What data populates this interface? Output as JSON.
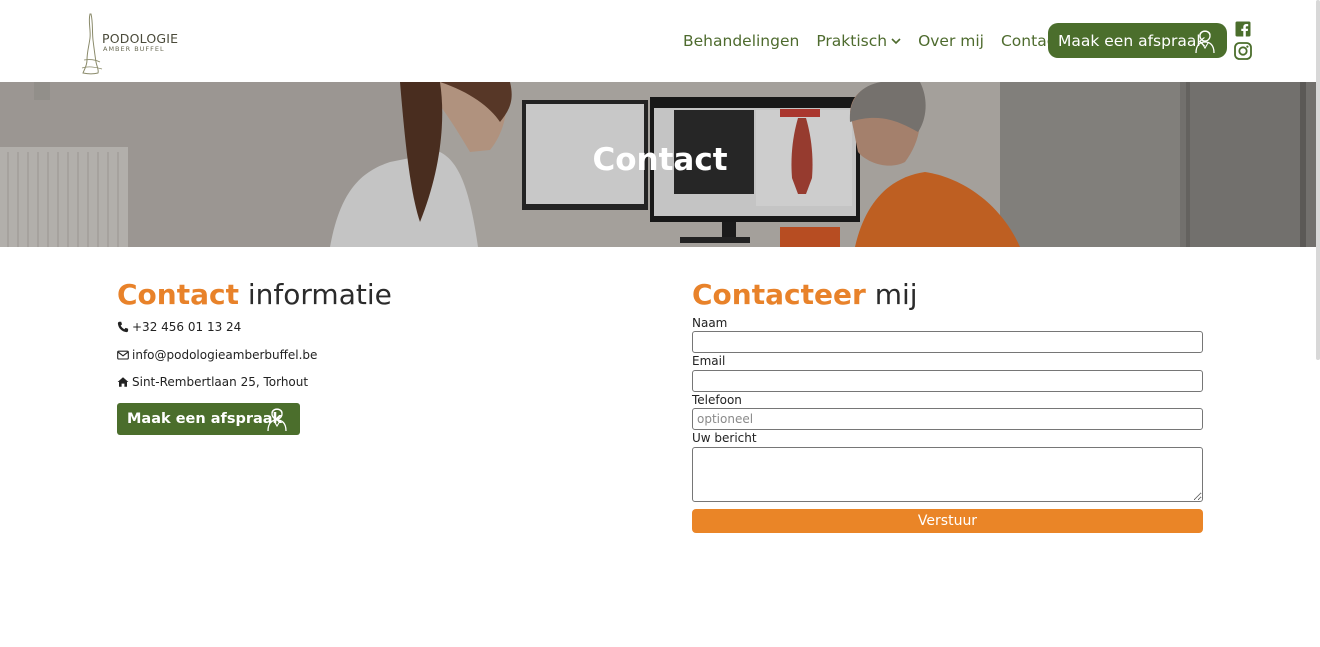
{
  "brand": {
    "name": "PODOLOGIE",
    "subtitle": "AMBER BUFFEL"
  },
  "nav": {
    "items": [
      "Behandelingen",
      "Praktisch",
      "Over mij",
      "Contact"
    ],
    "cta_label": "Maak een afspraak"
  },
  "hero": {
    "title": "Contact"
  },
  "contact_info": {
    "heading_accent": "Contact",
    "heading_rest": "informatie",
    "phone": "+32 456 01 13 24",
    "email": "info@podologieamberbuffel.be",
    "address": "Sint-Rembertlaan 25, Torhout",
    "cta_label": "Maak een afspraak"
  },
  "form": {
    "heading_accent": "Contacteer",
    "heading_rest": "mij",
    "fields": [
      {
        "label": "Naam",
        "value": "",
        "placeholder": ""
      },
      {
        "label": "Email",
        "value": "",
        "placeholder": ""
      },
      {
        "label": "Telefoon",
        "value": "",
        "placeholder": "optioneel"
      },
      {
        "label": "Uw bericht",
        "value": "",
        "placeholder": ""
      }
    ],
    "submit_label": "Verstuur"
  },
  "colors": {
    "green": "#4b6e2c",
    "orange": "#e8822a",
    "nav_text": "#4e6b2e"
  },
  "icons": [
    "phone-icon",
    "envelope-icon",
    "home-icon",
    "facebook-icon",
    "instagram-icon",
    "chevron-down-icon",
    "podiatrist-icon"
  ]
}
